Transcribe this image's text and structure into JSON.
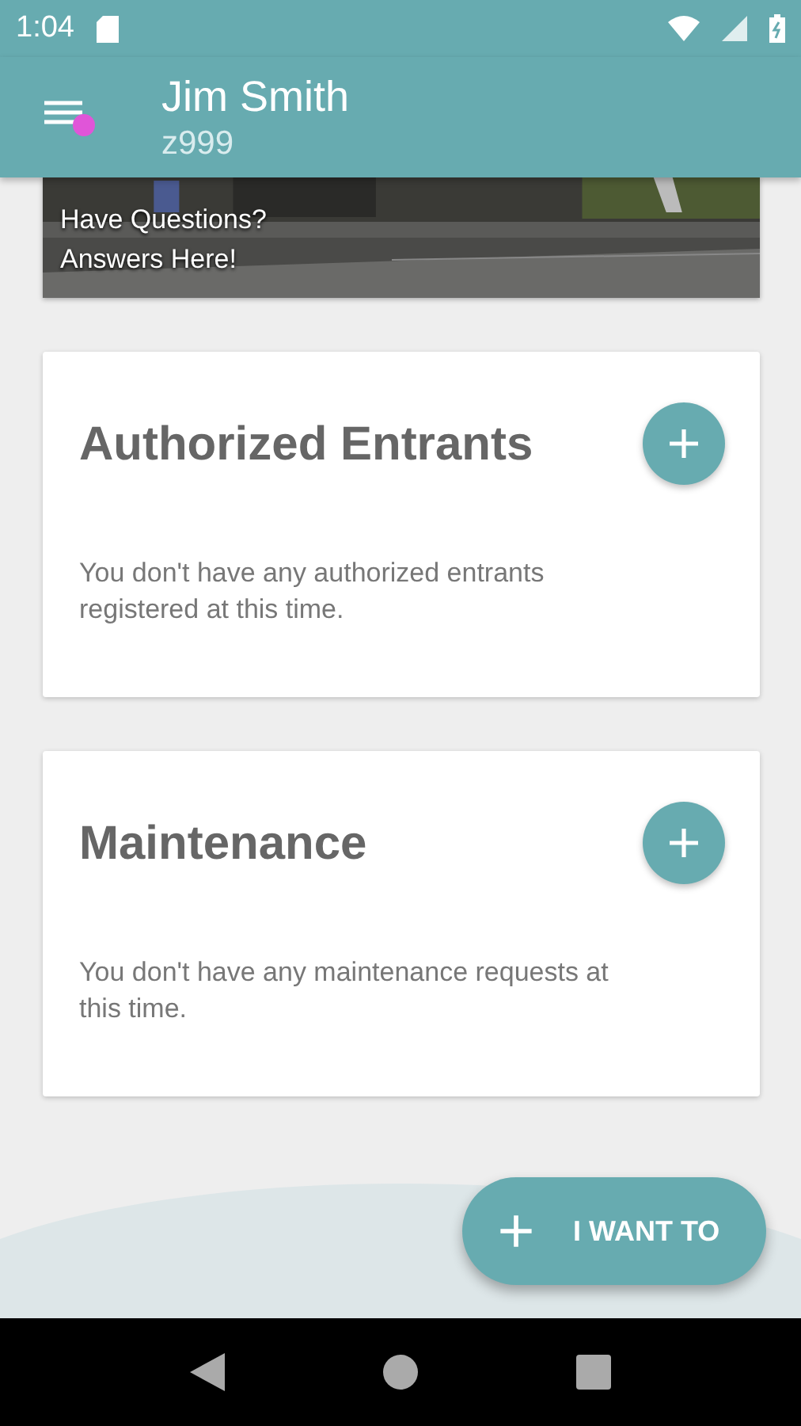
{
  "status_bar": {
    "time": "1:04"
  },
  "header": {
    "name": "Jim Smith",
    "id": "z999"
  },
  "banner": {
    "kind": "picture",
    "lines": [
      "Have Questions?",
      "Answers Here!"
    ]
  },
  "cards": [
    {
      "title": "Authorized Entrants",
      "message": "You don't have any authorized entrants registered at this time."
    },
    {
      "title": "Maintenance",
      "message": "You don't have any maintenance requests at this time."
    }
  ],
  "fab": {
    "label": "I WANT TO"
  }
}
